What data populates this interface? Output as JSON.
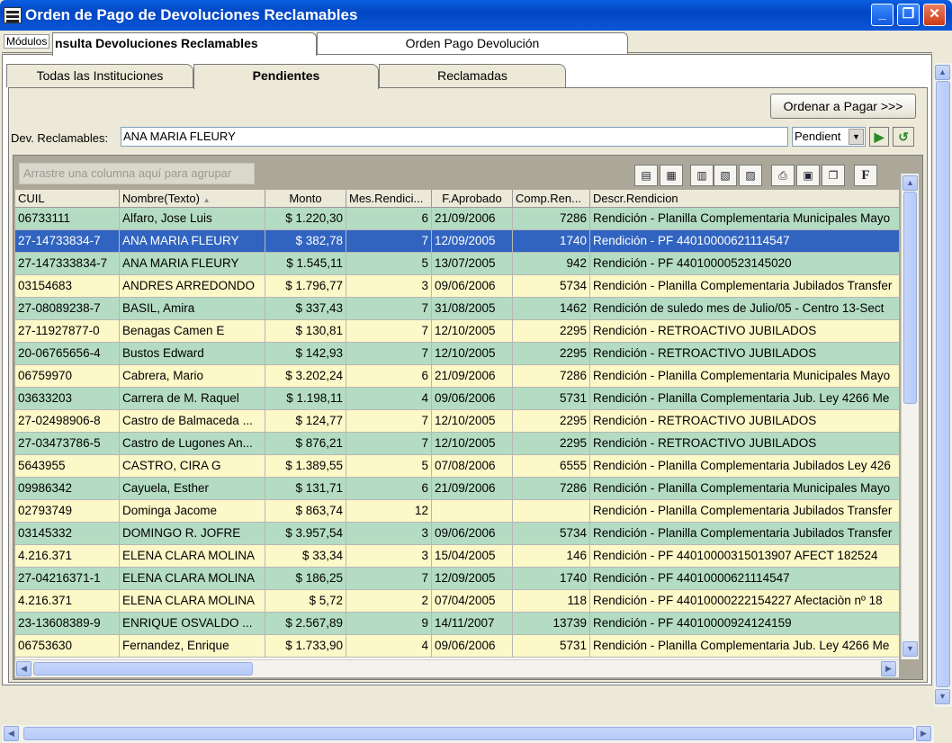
{
  "window": {
    "title": "Orden de Pago de Devoluciones Reclamables",
    "minimize": "_",
    "restore": "❐",
    "close": "✕"
  },
  "modules_label": "Módulos",
  "top_tabs": [
    "nsulta Devoluciones Reclamables",
    "Orden Pago Devolución"
  ],
  "sub_tabs": [
    "Todas las Instituciones",
    "Pendientes",
    "Reclamadas"
  ],
  "ordenar_button": "Ordenar a Pagar >>>",
  "dev_label": "Dev. Reclamables:",
  "dev_value": "ANA MARIA FLEURY",
  "filter_value": "Pendient",
  "group_placeholder": "Arrastre una columna aquí para agrupar",
  "columns": [
    "CUIL",
    "Nombre(Texto)",
    "Monto",
    "Mes.Rendici...",
    "F.Aprobado",
    "Comp.Ren...",
    "Descr.Rendicion"
  ],
  "sort_indicator": "▲",
  "rows": [
    {
      "cuil": "06733111",
      "nombre": "Alfaro, Jose Luis",
      "monto": "$ 1.220,30",
      "mes": "6",
      "fecha": "21/09/2006",
      "comp": "7286",
      "descr": "Rendición - Planilla Complementaria Municipales Mayo"
    },
    {
      "cuil": "27-14733834-7",
      "nombre": "ANA MARIA FLEURY",
      "monto": "$ 382,78",
      "mes": "7",
      "fecha": "12/09/2005",
      "comp": "1740",
      "descr": "Rendición - PF 44010000621114547"
    },
    {
      "cuil": "27-147333834-7",
      "nombre": "ANA MARIA FLEURY",
      "monto": "$ 1.545,11",
      "mes": "5",
      "fecha": "13/07/2005",
      "comp": "942",
      "descr": "Rendición - PF 44010000523145020"
    },
    {
      "cuil": "03154683",
      "nombre": "ANDRES ARREDONDO",
      "monto": "$ 1.796,77",
      "mes": "3",
      "fecha": "09/06/2006",
      "comp": "5734",
      "descr": "Rendición - Planilla Complementaria Jubilados Transfer"
    },
    {
      "cuil": "27-08089238-7",
      "nombre": "BASIL, Amira",
      "monto": "$ 337,43",
      "mes": "7",
      "fecha": "31/08/2005",
      "comp": "1462",
      "descr": "Rendición de suledo mes de Julio/05 - Centro 13-Sect"
    },
    {
      "cuil": "27-11927877-0",
      "nombre": "Benagas Camen E",
      "monto": "$ 130,81",
      "mes": "7",
      "fecha": "12/10/2005",
      "comp": "2295",
      "descr": "Rendición - RETROACTIVO JUBILADOS"
    },
    {
      "cuil": "20-06765656-4",
      "nombre": "Bustos Edward",
      "monto": "$ 142,93",
      "mes": "7",
      "fecha": "12/10/2005",
      "comp": "2295",
      "descr": "Rendición - RETROACTIVO JUBILADOS"
    },
    {
      "cuil": "06759970",
      "nombre": "Cabrera, Mario",
      "monto": "$ 3.202,24",
      "mes": "6",
      "fecha": "21/09/2006",
      "comp": "7286",
      "descr": "Rendición - Planilla Complementaria Municipales Mayo"
    },
    {
      "cuil": "03633203",
      "nombre": "Carrera de M. Raquel",
      "monto": "$ 1.198,11",
      "mes": "4",
      "fecha": "09/06/2006",
      "comp": "5731",
      "descr": "Rendición - Planilla Complementaria Jub. Ley 4266 Me"
    },
    {
      "cuil": "27-02498906-8",
      "nombre": "Castro de Balmaceda ...",
      "monto": "$ 124,77",
      "mes": "7",
      "fecha": "12/10/2005",
      "comp": "2295",
      "descr": "Rendición - RETROACTIVO JUBILADOS"
    },
    {
      "cuil": "27-03473786-5",
      "nombre": "Castro de Lugones An...",
      "monto": "$ 876,21",
      "mes": "7",
      "fecha": "12/10/2005",
      "comp": "2295",
      "descr": "Rendición - RETROACTIVO JUBILADOS"
    },
    {
      "cuil": "5643955",
      "nombre": "CASTRO, CIRA G",
      "monto": "$ 1.389,55",
      "mes": "5",
      "fecha": "07/08/2006",
      "comp": "6555",
      "descr": "Rendición - Planilla Complementaria Jubilados Ley 426"
    },
    {
      "cuil": "09986342",
      "nombre": "Cayuela, Esther",
      "monto": "$ 131,71",
      "mes": "6",
      "fecha": "21/09/2006",
      "comp": "7286",
      "descr": "Rendición - Planilla Complementaria Municipales Mayo"
    },
    {
      "cuil": "02793749",
      "nombre": "Dominga Jacome",
      "monto": "$ 863,74",
      "mes": "12",
      "fecha": "",
      "comp": "",
      "descr": "Rendición - Planilla Complementaria Jubilados Transfer"
    },
    {
      "cuil": "03145332",
      "nombre": "DOMINGO R. JOFRE",
      "monto": "$ 3.957,54",
      "mes": "3",
      "fecha": "09/06/2006",
      "comp": "5734",
      "descr": "Rendición - Planilla Complementaria Jubilados Transfer"
    },
    {
      "cuil": "4.216.371",
      "nombre": "ELENA CLARA MOLINA",
      "monto": "$ 33,34",
      "mes": "3",
      "fecha": "15/04/2005",
      "comp": "146",
      "descr": "Rendición - PF 44010000315013907 AFECT 182524"
    },
    {
      "cuil": "27-04216371-1",
      "nombre": "ELENA CLARA MOLINA",
      "monto": "$ 186,25",
      "mes": "7",
      "fecha": "12/09/2005",
      "comp": "1740",
      "descr": "Rendición - PF 44010000621114547"
    },
    {
      "cuil": "4.216.371",
      "nombre": "ELENA CLARA MOLINA",
      "monto": "$ 5,72",
      "mes": "2",
      "fecha": "07/04/2005",
      "comp": "118",
      "descr": "Rendición - PF 44010000222154227 Afectaciòn nº 18"
    },
    {
      "cuil": "23-13608389-9",
      "nombre": "ENRIQUE OSVALDO ...",
      "monto": "$ 2.567,89",
      "mes": "9",
      "fecha": "14/11/2007",
      "comp": "13739",
      "descr": "Rendición - PF 44010000924124159"
    },
    {
      "cuil": "06753630",
      "nombre": "Fernandez, Enrique",
      "monto": "$ 1.733,90",
      "mes": "4",
      "fecha": "09/06/2006",
      "comp": "5731",
      "descr": "Rendición - Planilla Complementaria Jub. Ley 4266 Me"
    }
  ],
  "selected_row": 1,
  "grid_tools": [
    "printer-icon",
    "export-icon",
    "columns-icon",
    "filter-icon",
    "sort-icon",
    "print-icon",
    "preview-icon",
    "copy-icon",
    "function-icon"
  ],
  "function_label": "F",
  "colors": {
    "row_even": "#fdf8c8",
    "row_odd": "#b4dcc2",
    "row_selected": "#3164c0",
    "title_bar": "#0246c4"
  }
}
